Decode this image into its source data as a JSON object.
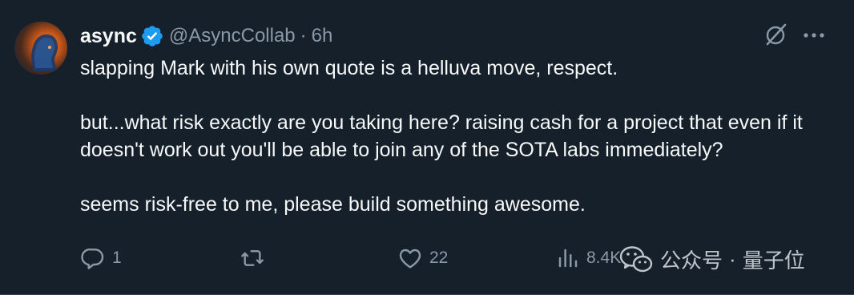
{
  "user": {
    "name": "async",
    "handle": "@AsyncCollab",
    "separator": "·",
    "time": "6h"
  },
  "tweet": {
    "paragraphs": [
      "slapping Mark with his own quote is a helluva move, respect.",
      "but...what risk exactly are you taking here? raising cash for a project that even if it doesn't work out you'll be able to join any of the SOTA labs immediately?",
      "seems risk-free to me, please build something awesome."
    ]
  },
  "actions": {
    "reply_count": "1",
    "retweet_count": "",
    "like_count": "22",
    "views_count": "8.4K"
  },
  "watermark": {
    "part1": "公众号",
    "separator": "·",
    "part2": "量子位"
  },
  "colors": {
    "background": "#15202b",
    "text": "#f7f9f9",
    "muted": "#8b98a5",
    "verified": "#1d9bf0",
    "border": "#38444d"
  },
  "icons": {
    "avatar": "avatar",
    "verified": "verified-badge-icon",
    "grok": "grok-icon",
    "more": "more-dots-icon",
    "reply": "reply-icon",
    "retweet": "retweet-icon",
    "like": "heart-icon",
    "views": "views-chart-icon",
    "watermark": "wechat-icon"
  }
}
